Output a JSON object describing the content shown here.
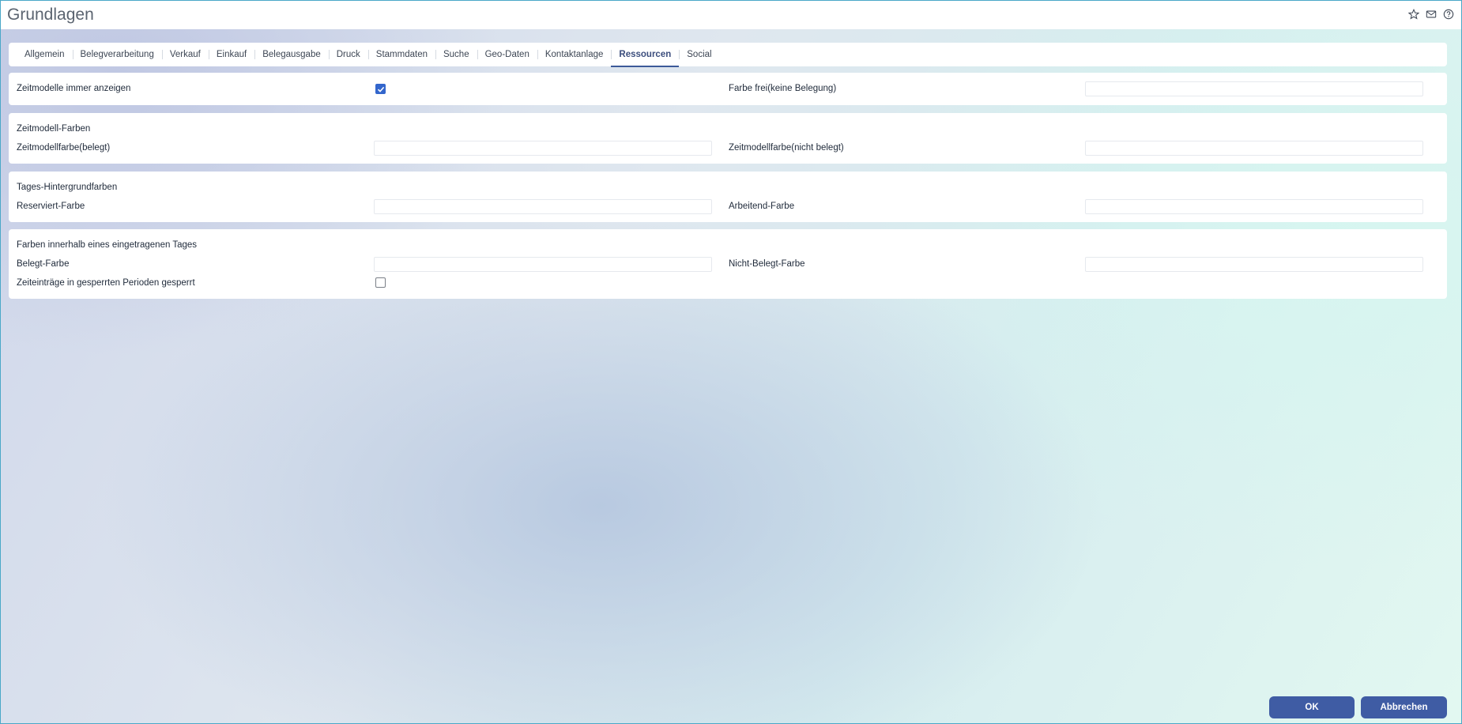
{
  "window": {
    "title": "Grundlagen",
    "icons": [
      "star-icon",
      "mail-icon",
      "help-icon"
    ]
  },
  "tabs": [
    {
      "label": "Allgemein",
      "active": false
    },
    {
      "label": "Belegverarbeitung",
      "active": false
    },
    {
      "label": "Verkauf",
      "active": false
    },
    {
      "label": "Einkauf",
      "active": false
    },
    {
      "label": "Belegausgabe",
      "active": false
    },
    {
      "label": "Druck",
      "active": false
    },
    {
      "label": "Stammdaten",
      "active": false
    },
    {
      "label": "Suche",
      "active": false
    },
    {
      "label": "Geo-Daten",
      "active": false
    },
    {
      "label": "Kontaktanlage",
      "active": false
    },
    {
      "label": "Ressourcen",
      "active": true
    },
    {
      "label": "Social",
      "active": false
    }
  ],
  "general": {
    "show_time_models_label": "Zeitmodelle immer anzeigen",
    "show_time_models_checked": true,
    "free_color_label": "Farbe frei(keine Belegung)",
    "free_color_value": ""
  },
  "time_model_colors": {
    "section_title": "Zeitmodell-Farben",
    "occupied_label": "Zeitmodellfarbe(belegt)",
    "occupied_value": "",
    "not_occupied_label": "Zeitmodellfarbe(nicht belegt)",
    "not_occupied_value": ""
  },
  "day_background_colors": {
    "section_title": "Tages-Hintergrundfarben",
    "reserved_label": "Reserviert-Farbe",
    "reserved_value": "",
    "working_label": "Arbeitend-Farbe",
    "working_value": ""
  },
  "day_entry_colors": {
    "section_title": "Farben innerhalb eines eingetragenen Tages",
    "occupied_label": "Belegt-Farbe",
    "occupied_value": "",
    "not_occupied_label": "Nicht-Belegt-Farbe",
    "not_occupied_value": "",
    "locked_periods_label": "Zeiteinträge in gesperrten Perioden gesperrt",
    "locked_periods_checked": false
  },
  "buttons": {
    "ok_label": "OK",
    "cancel_label": "Abbrechen"
  },
  "colors": {
    "accent": "#3f5ca4",
    "checkbox_checked": "#3366cc",
    "active_tab": "#3c4e7d"
  }
}
